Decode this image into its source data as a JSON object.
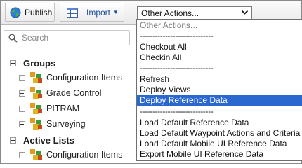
{
  "toolbar": {
    "publish_label": "Publish",
    "import_label": "Import",
    "actions_select_value": "Other Actions..."
  },
  "search": {
    "placeholder": "Search"
  },
  "tree": {
    "groups_label": "Groups",
    "group_items": [
      "Configuration Items",
      "Grade Control",
      "PITRAM",
      "Surveying"
    ],
    "active_lists_label": "Active Lists",
    "active_list_items": [
      "Configuration Items"
    ]
  },
  "dropdown": {
    "items": [
      "Other Actions...",
      "-----------------------------",
      "Checkout All",
      "Checkin All",
      "-----------------------------",
      "Refresh",
      "Deploy Views",
      "Deploy Reference Data",
      "-----------------------------",
      "Load Default Reference Data",
      "Load Default Waypoint Actions and Criteria",
      "Load Default Mobile UI Reference Data",
      "Export Mobile UI Reference Data"
    ],
    "selected": "Deploy Reference Data"
  },
  "colors": {
    "selection": "#2a68d0",
    "import_text": "#1f4e9c",
    "leaf_icon_green": "#3b9a3b",
    "leaf_icon_orange": "#e29a1f"
  },
  "icons": [
    "globe-icon",
    "grid-icon",
    "search-icon",
    "chevron-down-icon",
    "expand-icon",
    "collapse-icon",
    "item-node-icon"
  ]
}
